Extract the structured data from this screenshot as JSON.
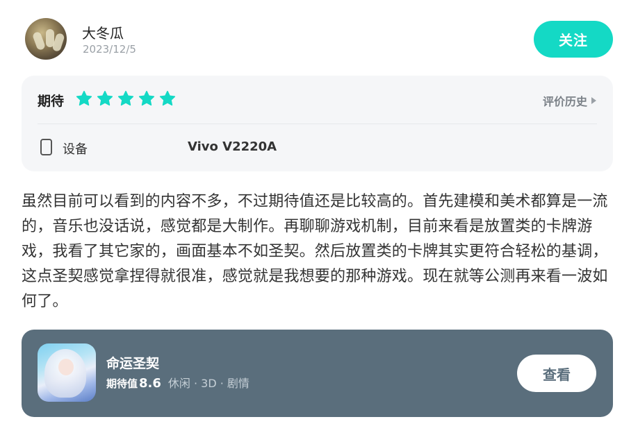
{
  "user": {
    "name": "大冬瓜",
    "date": "2023/12/5",
    "follow_label": "关注"
  },
  "rating": {
    "label": "期待",
    "stars": 5,
    "star_color": "#14d9c5",
    "history_label": "评价历史",
    "device_label": "设备",
    "device_value": "Vivo V2220A"
  },
  "review": {
    "text": "虽然目前可以看到的内容不多，不过期待值还是比较高的。首先建模和美术都算是一流的，音乐也没话说，感觉都是大制作。再聊聊游戏机制，目前来看是放置类的卡牌游戏，我看了其它家的，画面基本不如圣契。然后放置类的卡牌其实更符合轻松的基调，这点圣契感觉拿捏得就很准，感觉就是我想要的那种游戏。现在就等公测再来看一波如何了。"
  },
  "game": {
    "title": "命运圣契",
    "expect_label": "期待值",
    "expect_value": "8.6",
    "tags": "休闲 · 3D · 剧情",
    "view_label": "查看",
    "card_color": "#5a6e7c"
  },
  "icons": {
    "avatar": "user-avatar",
    "star": "star-icon",
    "history_arrow": "triangle-right-icon",
    "device": "phone-icon",
    "game": "game-icon"
  },
  "colors": {
    "accent": "#14d9c5",
    "secondary_text": "#9aa0a6"
  }
}
